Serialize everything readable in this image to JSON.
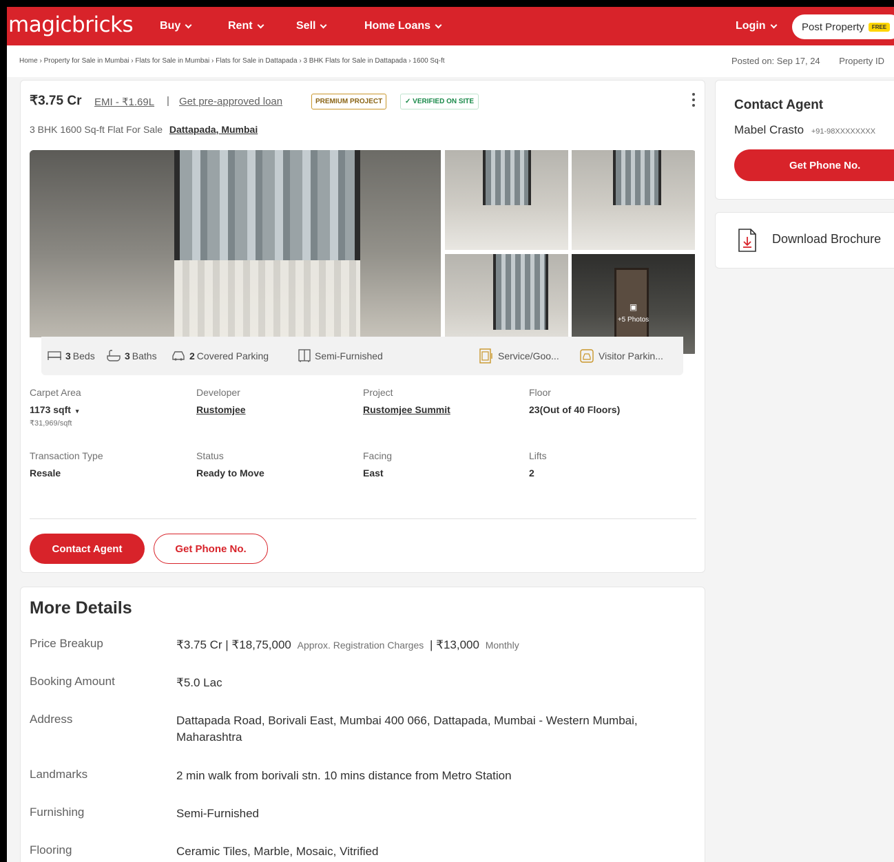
{
  "header": {
    "logo": "magicbricks",
    "nav": [
      {
        "label": "Buy"
      },
      {
        "label": "Rent"
      },
      {
        "label": "Sell"
      },
      {
        "label": "Home Loans"
      }
    ],
    "login": "Login",
    "post_property": "Post Property",
    "post_badge": "FREE"
  },
  "breadcrumb": {
    "items": [
      "Home",
      "Property for Sale in Mumbai",
      "Flats for Sale in Mumbai",
      "Flats for Sale in Dattapada",
      "3 BHK Flats for Sale in Dattapada",
      "1600 Sq-ft"
    ],
    "posted_on": "Posted on: Sep 17, 24",
    "property_id_label": "Property ID"
  },
  "listing": {
    "price": "₹3.75 Cr",
    "emi": "EMI - ₹1.69L",
    "separator": "|",
    "loan_link": "Get pre-approved loan",
    "badge_premium": "PREMIUM PROJECT",
    "badge_verified": "VERIFIED ON SITE",
    "title": "3 BHK 1600 Sq-ft Flat For Sale",
    "location": "Dattapada, Mumbai",
    "more_photos": "+5 Photos"
  },
  "amenities": {
    "beds_num": "3",
    "beds_label": "Beds",
    "baths_num": "3",
    "baths_label": "Baths",
    "parking_num": "2",
    "parking_label": "Covered Parking",
    "furnishing": "Semi-Furnished",
    "service": "Service/Goo...",
    "visitor": "Visitor Parkin..."
  },
  "details": {
    "carpet_label": "Carpet Area",
    "carpet_value": "1173 sqft",
    "carpet_sub": "₹31,969/sqft",
    "developer_label": "Developer",
    "developer_value": "Rustomjee",
    "project_label": "Project",
    "project_value": "Rustomjee Summit",
    "floor_label": "Floor",
    "floor_value": "23(Out of 40 Floors)",
    "transaction_label": "Transaction Type",
    "transaction_value": "Resale",
    "status_label": "Status",
    "status_value": "Ready to Move",
    "facing_label": "Facing",
    "facing_value": "East",
    "lifts_label": "Lifts",
    "lifts_value": "2"
  },
  "actions": {
    "contact_agent": "Contact Agent",
    "get_phone": "Get Phone No."
  },
  "more_details": {
    "title": "More Details",
    "price_label": "Price Breakup",
    "price_value_a": "₹3.75 Cr | ₹18,75,000",
    "price_note_a": "Approx. Registration Charges",
    "price_value_b": "| ₹13,000",
    "price_note_b": "Monthly",
    "booking_label": "Booking Amount",
    "booking_value": "₹5.0 Lac",
    "address_label": "Address",
    "address_value": "Dattapada Road, Borivali East, Mumbai 400 066, Dattapada, Mumbai - Western Mumbai, Maharashtra",
    "landmarks_label": "Landmarks",
    "landmarks_value": "2 min walk from borivali stn. 10 mins distance from Metro Station",
    "furnishing_label": "Furnishing",
    "furnishing_value": "Semi-Furnished",
    "flooring_label": "Flooring",
    "flooring_value": "Ceramic Tiles, Marble, Mosaic, Vitrified"
  },
  "sidebar": {
    "contact_title": "Contact Agent",
    "agent_name": "Mabel Crasto",
    "agent_phone": "+91-98XXXXXXXX",
    "get_phone": "Get Phone No.",
    "download": "Download Brochure"
  },
  "colors": {
    "brand_red": "#d8232a",
    "premium_gold": "#c9962a",
    "verified_green": "#1a8a4a"
  }
}
